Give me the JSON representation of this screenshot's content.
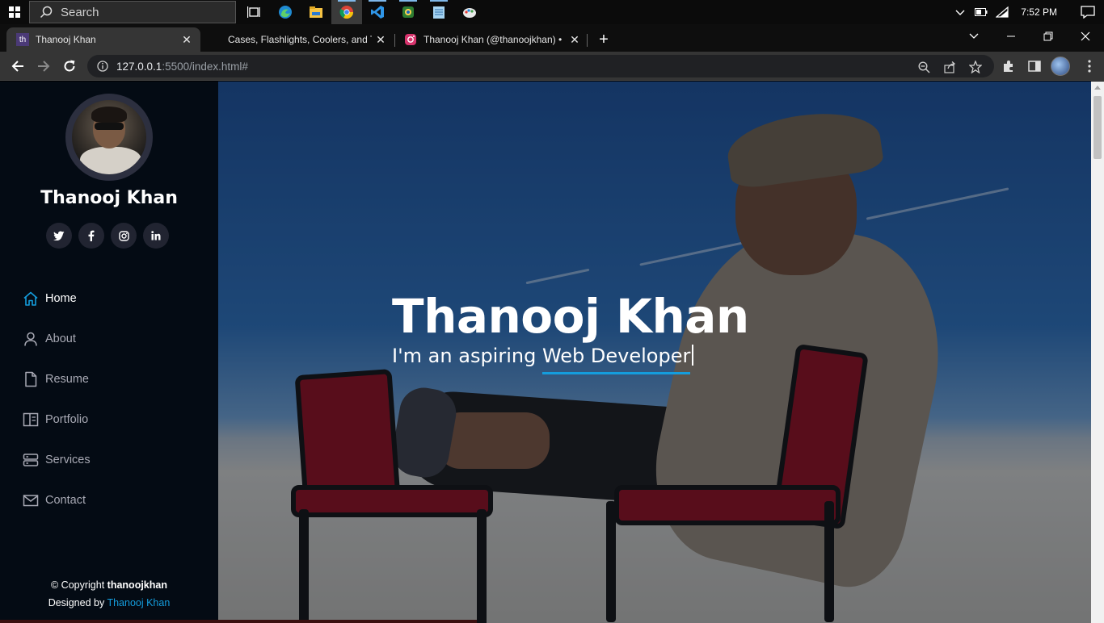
{
  "taskbar": {
    "search_placeholder": "Search",
    "time": "7:52 PM",
    "apps": [
      "task-view",
      "edge",
      "file-explorer",
      "chrome",
      "vscode",
      "camera",
      "notepad",
      "paint"
    ]
  },
  "browser": {
    "tabs": [
      {
        "title": "Thanooj Khan",
        "favicon": "th",
        "active": true
      },
      {
        "title": "Cases, Flashlights, Coolers, and Tr",
        "active": false
      },
      {
        "title": "Thanooj Khan (@thanoojkhan) •",
        "active": false
      }
    ],
    "url_host": "127.0.0.1",
    "url_rest": ":5500/index.html#"
  },
  "sidebar": {
    "name": "Thanooj Khan",
    "socials": [
      {
        "icon": "twitter-icon",
        "glyph": "t"
      },
      {
        "icon": "facebook-icon",
        "glyph": "f"
      },
      {
        "icon": "instagram-icon",
        "glyph": "◎"
      },
      {
        "icon": "linkedin-icon",
        "glyph": "in"
      }
    ],
    "nav": [
      {
        "label": "Home",
        "icon": "home-icon",
        "active": true
      },
      {
        "label": "About",
        "icon": "user-icon"
      },
      {
        "label": "Resume",
        "icon": "file-icon"
      },
      {
        "label": "Portfolio",
        "icon": "book-icon"
      },
      {
        "label": "Services",
        "icon": "server-icon"
      },
      {
        "label": "Contact",
        "icon": "envelope-icon"
      }
    ],
    "footer": {
      "copyright_prefix": "© Copyright",
      "copyright_owner": "thanoojkhan",
      "designed_prefix": "Designed by",
      "designed_by": "Thanooj Khan"
    }
  },
  "hero": {
    "title": "Thanooj Khan",
    "subtitle_prefix": "I'm an aspiring",
    "subtitle_typed": "Web Developer"
  },
  "colors": {
    "accent": "#149ddd",
    "sidebar_bg": "#040b14"
  }
}
